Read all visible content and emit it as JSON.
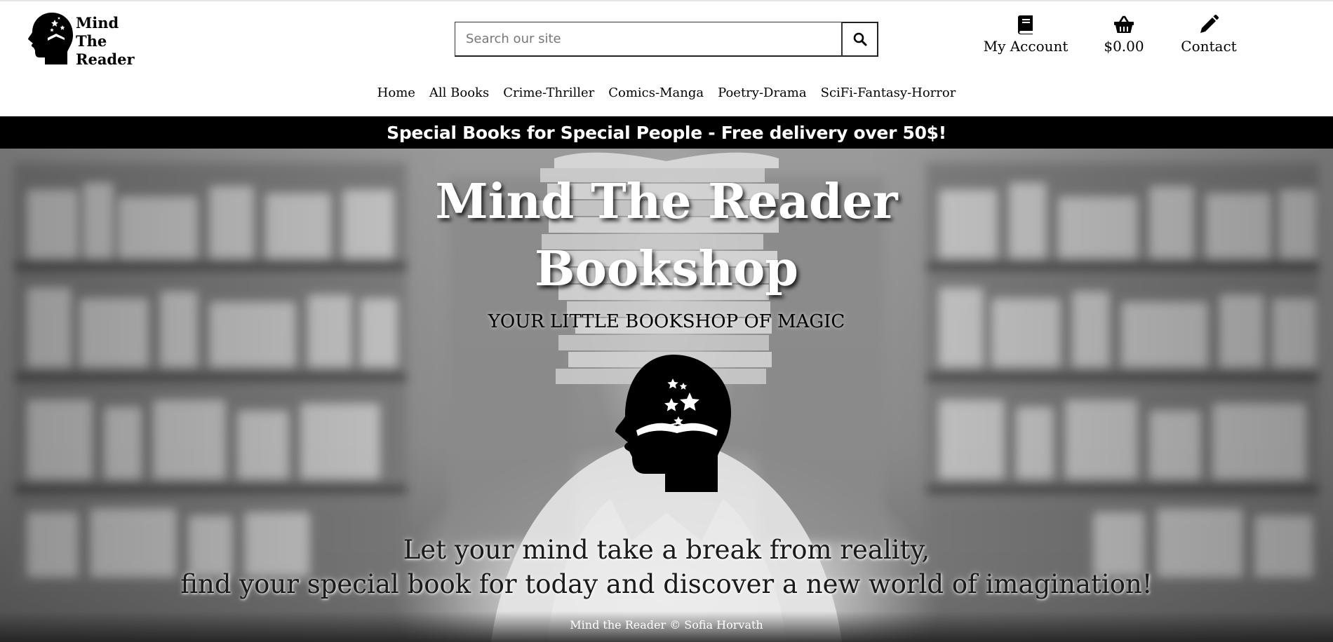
{
  "brand": {
    "logo_lines": [
      "Mind",
      "The",
      "Reader"
    ],
    "logo_icon": "head-book-stars-icon"
  },
  "search": {
    "placeholder": "Search our site",
    "value": "",
    "button_icon": "search-icon"
  },
  "header_nav": [
    {
      "label": "My Account",
      "icon": "book-icon"
    },
    {
      "label": "$0.00",
      "icon": "basket-icon"
    },
    {
      "label": "Contact",
      "icon": "pencil-icon"
    }
  ],
  "main_nav": [
    "Home",
    "All Books",
    "Crime-Thriller",
    "Comics-Manga",
    "Poetry-Drama",
    "SciFi-Fantasy-Horror"
  ],
  "banner": {
    "text": "Special Books for Special People - Free delivery over 50$!"
  },
  "hero": {
    "title_lines": [
      "Mind The Reader",
      "Bookshop"
    ],
    "subtitle": "YOUR LITTLE BOOKSHOP OF MAGIC",
    "message_lines": [
      "Let your mind take a break from reality,",
      "find your special book for today and discover a new world of imagination!"
    ],
    "head_icon": "head-book-stars-icon"
  },
  "footer": {
    "text": "Mind the Reader © Sofia Horvath"
  },
  "colors": {
    "banner_bg": "#000000",
    "banner_text": "#ffffff",
    "header_bg": "#ffffff"
  }
}
